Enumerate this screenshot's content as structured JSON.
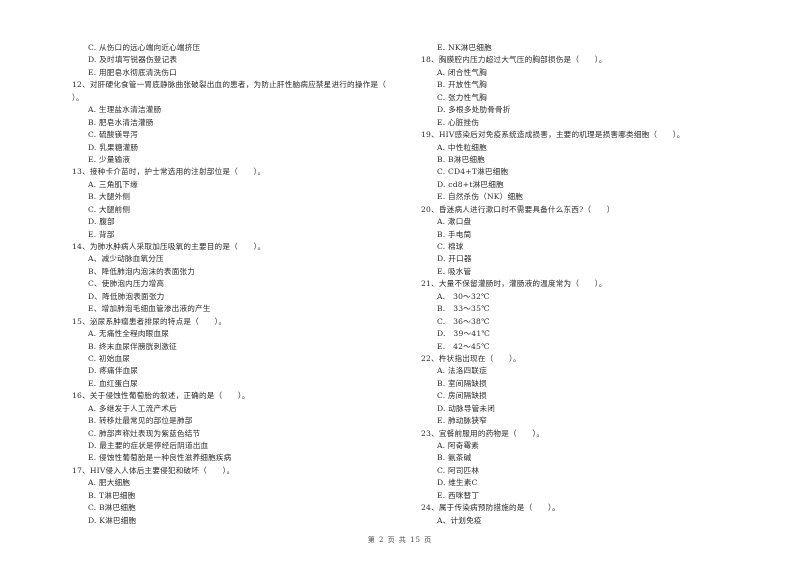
{
  "page": {
    "footer": "第 2 页 共 15 页"
  },
  "left_column": [
    {
      "type": "opt",
      "text": "C. 从伤口的远心端向近心端挤压"
    },
    {
      "type": "opt",
      "text": "D. 及时填写锐器伤登记表"
    },
    {
      "type": "opt",
      "text": "E. 用肥皂水彻底清洗伤口"
    },
    {
      "type": "q",
      "text": "12、对肝硬化食管一胃底静脉曲张破裂出血的患者，为防止肝性脑病应禁星进行的操作是（"
    },
    {
      "type": "cont",
      "text": "）。"
    },
    {
      "type": "opt",
      "text": "A. 生理盐水清洁灌肠"
    },
    {
      "type": "opt",
      "text": "B. 肥皂水清洁灌肠"
    },
    {
      "type": "opt",
      "text": "C. 硫酸镁导泻"
    },
    {
      "type": "opt",
      "text": "D. 乳果糖灌肠"
    },
    {
      "type": "opt",
      "text": "E. 少量输液"
    },
    {
      "type": "q",
      "text": "13、接种卡介苗时，护士常选用的注射部位是（　　）。"
    },
    {
      "type": "opt",
      "text": "A. 三角肌下缘"
    },
    {
      "type": "opt",
      "text": "B. 大腿外侧"
    },
    {
      "type": "opt",
      "text": "C. 大腿前侧"
    },
    {
      "type": "opt",
      "text": "D. 腹部"
    },
    {
      "type": "opt",
      "text": "E. 背部"
    },
    {
      "type": "q",
      "text": "14、为肺水肿病人采取加压吸氧的主要目的是（　　）。"
    },
    {
      "type": "opt",
      "text": "A、减少动脉血氧分压"
    },
    {
      "type": "opt",
      "text": "B、降低肺泡内泡沫的表面张力"
    },
    {
      "type": "opt",
      "text": "C、使肺泡内压力增高"
    },
    {
      "type": "opt",
      "text": "D、降低肺泡表面张力"
    },
    {
      "type": "opt",
      "text": "E、增加肺泡毛细血管渗出液的产生"
    },
    {
      "type": "q",
      "text": "15、泌尿系肿瘤患者排尿的特点是（　　）。"
    },
    {
      "type": "opt",
      "text": "A. 无痛性全程肉眼血尿"
    },
    {
      "type": "opt",
      "text": "B. 终末血尿伴膀胱刺激征"
    },
    {
      "type": "opt",
      "text": "C. 初始血尿"
    },
    {
      "type": "opt",
      "text": "D. 疼痛伴血尿"
    },
    {
      "type": "opt",
      "text": "E. 血红蛋白尿"
    },
    {
      "type": "q",
      "text": "16、关于侵蚀性葡萄胎的叙述，正确的是（　　）。"
    },
    {
      "type": "opt",
      "text": "A. 多继发于人工流产术后"
    },
    {
      "type": "opt",
      "text": "B. 转移灶最常见的部位是肺部"
    },
    {
      "type": "opt",
      "text": "C. 肺部声称灶表现为紫蓝色结节"
    },
    {
      "type": "opt",
      "text": "D. 最主要的症状是停经后阴道出血"
    },
    {
      "type": "opt",
      "text": "E. 侵蚀性葡萄胎是一种良性滋养细胞疾病"
    },
    {
      "type": "q",
      "text": "17、HIV侵入人体后主要侵犯和破坏（　　）。"
    },
    {
      "type": "opt",
      "text": "A. 肥大细胞"
    },
    {
      "type": "opt",
      "text": "B. T淋巴细胞"
    },
    {
      "type": "opt",
      "text": "C. B淋巴细胞"
    },
    {
      "type": "opt",
      "text": "D. K淋巴细胞"
    }
  ],
  "right_column": [
    {
      "type": "opt",
      "text": "E. NK淋巴细胞"
    },
    {
      "type": "q",
      "text": "18、胸膜腔内压力超过大气压的胸部损伤是（　　）。"
    },
    {
      "type": "opt",
      "text": "A. 闭合性气胸"
    },
    {
      "type": "opt",
      "text": "B. 开放性气胸"
    },
    {
      "type": "opt",
      "text": "C. 张力性气胸"
    },
    {
      "type": "opt",
      "text": "D. 多根多处肋骨骨折"
    },
    {
      "type": "opt",
      "text": "E. 心脏挫伤"
    },
    {
      "type": "q",
      "text": "19、HIV感染后对免疫系统造成损害，主要的机理是损害哪类细胞（　　）。"
    },
    {
      "type": "opt",
      "text": "A. 中性粒细胞"
    },
    {
      "type": "opt",
      "text": "B. B淋巴细胞"
    },
    {
      "type": "opt",
      "text": "C. CD4+T淋巴细胞"
    },
    {
      "type": "opt",
      "text": "D. cd8+t淋巴细胞"
    },
    {
      "type": "opt",
      "text": "E. 自然杀伤（NK）细胞"
    },
    {
      "type": "q",
      "text": "20、昏迷病人进行漱口时不需要具备什么东西?（　　）"
    },
    {
      "type": "opt",
      "text": "A. 漱口盘"
    },
    {
      "type": "opt",
      "text": "B. 手电筒"
    },
    {
      "type": "opt",
      "text": "C. 棉球"
    },
    {
      "type": "opt",
      "text": "D. 开口器"
    },
    {
      "type": "opt",
      "text": "E. 吸水管"
    },
    {
      "type": "q",
      "text": "21、大量不保留灌肠时，灌肠液的温度常为（　　）。"
    },
    {
      "type": "opt",
      "text": "A.　30～32℃"
    },
    {
      "type": "opt",
      "text": "B.　33～35℃"
    },
    {
      "type": "opt",
      "text": "C.　36～38℃"
    },
    {
      "type": "opt",
      "text": "D.　39～41℃"
    },
    {
      "type": "opt",
      "text": "E.　42～45℃"
    },
    {
      "type": "q",
      "text": "22、杵状指出现在（　　）。"
    },
    {
      "type": "opt",
      "text": "A. 法洛四联症"
    },
    {
      "type": "opt",
      "text": "B. 室间隔缺损"
    },
    {
      "type": "opt",
      "text": "C. 房间隔缺损"
    },
    {
      "type": "opt",
      "text": "D. 动脉导管未闭"
    },
    {
      "type": "opt",
      "text": "E. 肺动脉狭窄"
    },
    {
      "type": "q",
      "text": "23、宜餐前服用的药物是（　　）。"
    },
    {
      "type": "opt",
      "text": "A. 阿奇霉素"
    },
    {
      "type": "opt",
      "text": "B. 氨茶碱"
    },
    {
      "type": "opt",
      "text": "C. 阿司匹林"
    },
    {
      "type": "opt",
      "text": "D. 维生素C"
    },
    {
      "type": "opt",
      "text": "E. 西咪替丁"
    },
    {
      "type": "q",
      "text": "24、属于传染病预防措施的是（　　）。"
    },
    {
      "type": "opt",
      "text": "A、计划免疫"
    }
  ]
}
